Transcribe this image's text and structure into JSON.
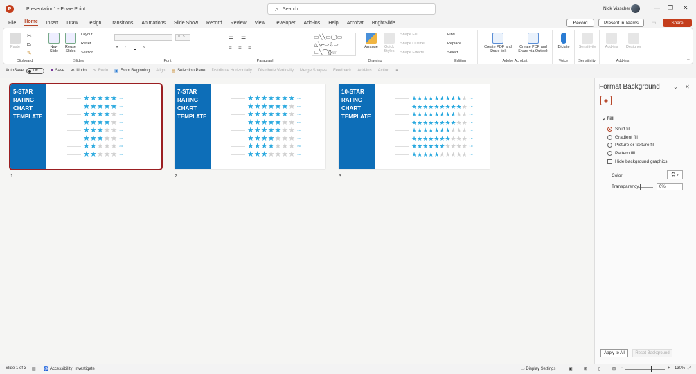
{
  "titlebar": {
    "app_icon": "P",
    "doc_title": "Presentation1  -  PowerPoint",
    "search_placeholder": "Search",
    "user_name": "Nick Visscher",
    "minimize": "—",
    "restore": "❐",
    "close": "✕"
  },
  "menu": {
    "tabs": [
      "File",
      "Home",
      "Insert",
      "Draw",
      "Design",
      "Transitions",
      "Animations",
      "Slide Show",
      "Record",
      "Review",
      "View",
      "Developer",
      "Add-ins",
      "Help",
      "Acrobat",
      "BrightSlide"
    ],
    "record_label": "Record",
    "teams_label": "Present in Teams",
    "share_label": "Share"
  },
  "ribbon": {
    "clipboard": {
      "label": "Clipboard",
      "paste": "Paste"
    },
    "slides": {
      "label": "Slides",
      "new_slide": "New Slide",
      "reuse": "Reuse Slides",
      "layout": "Layout",
      "reset": "Reset",
      "section": "Section"
    },
    "font": {
      "label": "Font",
      "size": "10.5",
      "bold": "B",
      "italic": "I",
      "underline": "U",
      "strike": "S"
    },
    "paragraph": {
      "label": "Paragraph"
    },
    "drawing": {
      "label": "Drawing",
      "arrange": "Arrange",
      "quick_styles": "Quick Styles",
      "shape_fill": "Shape Fill",
      "shape_outline": "Shape Outline",
      "shape_effects": "Shape Effects"
    },
    "editing": {
      "label": "Editing",
      "find": "Find",
      "replace": "Replace",
      "select": "Select"
    },
    "acrobat": {
      "label": "Adobe Acrobat",
      "create_pdf_share": "Create PDF and Share link",
      "create_pdf_outlook": "Create PDF and Share via Outlook"
    },
    "voice": {
      "label": "Voice",
      "dictate": "Dictate"
    },
    "sensitivity": {
      "label": "Sensitivity",
      "btn": "Sensitivity"
    },
    "addins": {
      "label": "Add-ins",
      "btn": "Add-ins",
      "designer": "Designer"
    }
  },
  "qat": {
    "autosave": "AutoSave",
    "autosave_state": "Off",
    "save": "Save",
    "undo": "Undo",
    "redo": "Redo",
    "from_beginning": "From Beginning",
    "align": "Align",
    "selection_pane": "Selection Pane",
    "dist_h": "Distribute Horizontally",
    "dist_v": "Distribute Vertically",
    "merge_shapes": "Merge Shapes",
    "feedback": "Feedback",
    "addins": "Add-ins",
    "action": "Action"
  },
  "slides": [
    {
      "num": "1",
      "title": "5-STAR RATING CHART TEMPLATE",
      "scale": 5,
      "rows": [
        {
          "rating": 5,
          "value": "5.00"
        },
        {
          "rating": 4.5,
          "value": "4.50"
        },
        {
          "rating": 4,
          "value": "4.00"
        },
        {
          "rating": 3.5,
          "value": "3.50"
        },
        {
          "rating": 3,
          "value": "3.00"
        },
        {
          "rating": 2.5,
          "value": "2.50"
        },
        {
          "rating": 2,
          "value": "2.00"
        },
        {
          "rating": 1.5,
          "value": "1.50"
        }
      ]
    },
    {
      "num": "2",
      "title": "7-STAR RATING CHART TEMPLATE",
      "scale": 7,
      "rows": [
        {
          "rating": 6.5,
          "value": "6.50"
        },
        {
          "rating": 6,
          "value": "6.00"
        },
        {
          "rating": 5.5,
          "value": "5.50"
        },
        {
          "rating": 5,
          "value": "5.00"
        },
        {
          "rating": 4.5,
          "value": "4.50"
        },
        {
          "rating": 4,
          "value": "4.00"
        },
        {
          "rating": 3.5,
          "value": "3.50"
        },
        {
          "rating": 3,
          "value": "3.00"
        }
      ]
    },
    {
      "num": "3",
      "title": "10-STAR RATING CHART TEMPLATE",
      "scale": 10,
      "rows": [
        {
          "rating": 9,
          "value": "9.00"
        },
        {
          "rating": 8.5,
          "value": "8.50"
        },
        {
          "rating": 8,
          "value": "8.00"
        },
        {
          "rating": 7.5,
          "value": "7.50"
        },
        {
          "rating": 7,
          "value": "7.00"
        },
        {
          "rating": 6.5,
          "value": "6.50"
        },
        {
          "rating": 6,
          "value": "6.00"
        },
        {
          "rating": 5,
          "value": "5.00"
        }
      ]
    }
  ],
  "pane": {
    "title": "Format Background",
    "fill_header": "Fill",
    "solid_fill": "Solid fill",
    "gradient_fill": "Gradient fill",
    "picture_fill": "Picture or texture fill",
    "pattern_fill": "Pattern fill",
    "hide_graphics": "Hide background graphics",
    "color_label": "Color",
    "transparency_label": "Transparency",
    "transparency_value": "0%",
    "apply_all": "Apply to All",
    "reset_bg": "Reset Background"
  },
  "status": {
    "slide_info": "Slide 1 of 3",
    "accessibility": "Accessibility: Investigate",
    "display_settings": "Display Settings",
    "zoom": "130%"
  },
  "colors": {
    "accent": "#b7472a",
    "slide_blue": "#0d6eb8",
    "star_blue": "#2aa9df",
    "share": "#c43e1c"
  }
}
